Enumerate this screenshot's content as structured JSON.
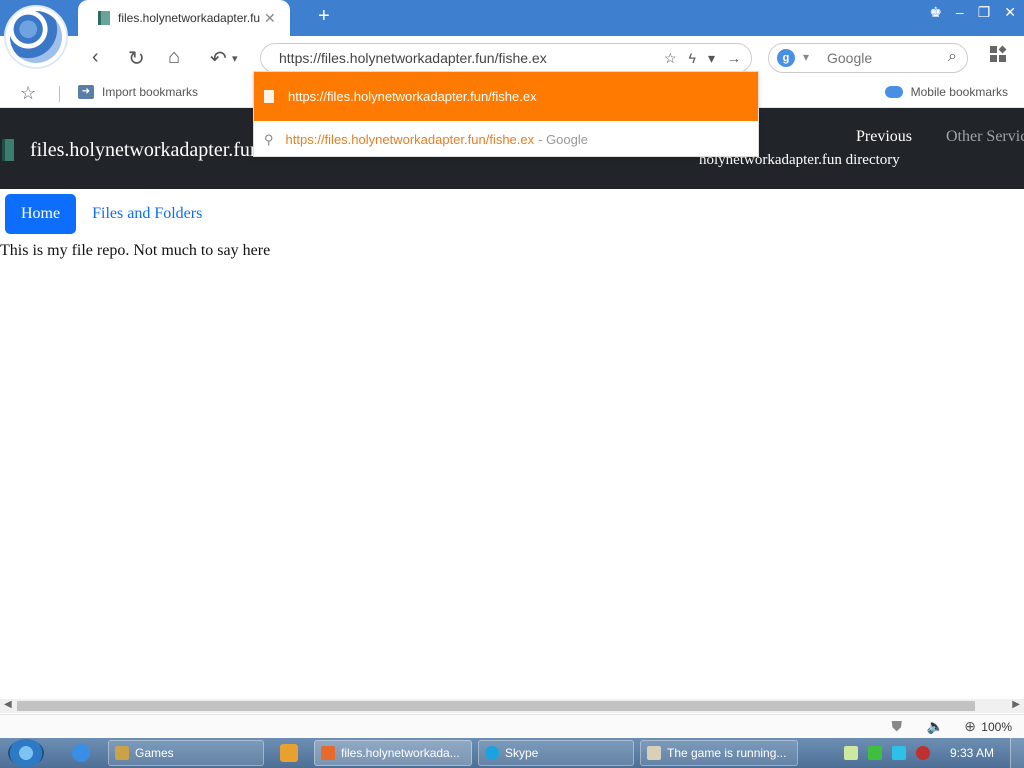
{
  "browser": {
    "tab_title": "files.holynetworkadapter.fun",
    "tab_close": "✕",
    "new_tab": "+",
    "address": "https://files.holynetworkadapter.fun/fishe.ex",
    "search_engine_letter": "g",
    "search_placeholder": "Google",
    "bookmarks": {
      "import_label": "Import bookmarks",
      "mobile_label": "Mobile bookmarks"
    }
  },
  "autocomplete": {
    "row1_url": "https://files.holynetworkadapter.fun/fishe.ex",
    "row2_url": "https://files.holynetworkadapter.fun/fishe.ex",
    "row2_source": "- Google"
  },
  "site": {
    "brand": "files.holynetworkadapter.fun",
    "nav_previous": "Previous",
    "nav_other": "Other Services",
    "directory_label": "holynetworkadapter.fun directory",
    "tab_home": "Home",
    "tab_files": "Files and Folders",
    "body_text": "This is my file repo. Not much to say here"
  },
  "status": {
    "zoom": "100%"
  },
  "taskbar": {
    "items": [
      {
        "label": "Games"
      },
      {
        "label": "files.holynetworkada..."
      },
      {
        "label": "Skype"
      },
      {
        "label": "The game is running..."
      }
    ],
    "clock": "9:33 AM"
  }
}
